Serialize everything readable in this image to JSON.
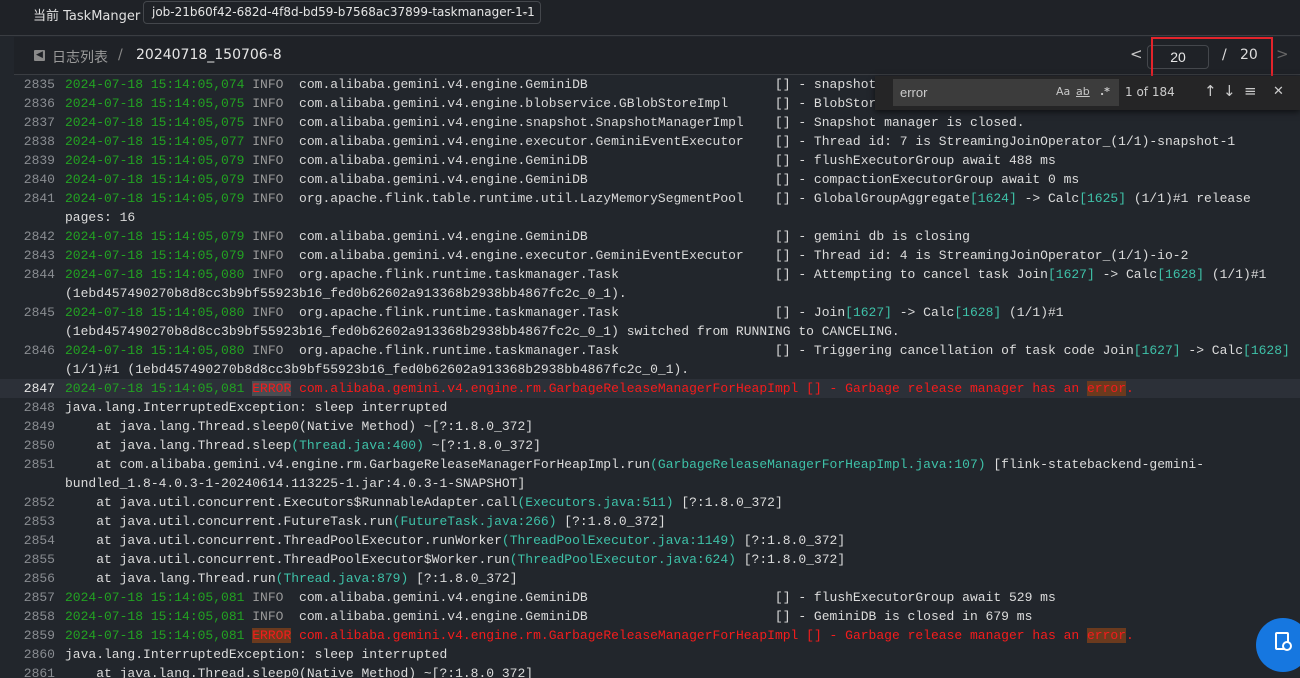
{
  "header": {
    "taskmanager_label": "当前 TaskManger :",
    "taskmanager_value": "job-21b60f42-682d-4f8d-bd59-b7568ac37899-taskmanager-1-1"
  },
  "breadcrumb": {
    "parent": "日志列表",
    "separator": "/",
    "current": "20240718_150706-8"
  },
  "pagination": {
    "prev": "<",
    "current": "20",
    "separator": "/",
    "total": "20",
    "next": ">"
  },
  "find": {
    "query": "error",
    "match_case": "Aa",
    "whole_word": "ab",
    "regex": ".*",
    "count": "1 of 184",
    "prev": "↑",
    "next": "↓",
    "selection": "≡",
    "close": "✕"
  },
  "colors": {
    "timestamp": "#22a322",
    "level": "#9a9a9a",
    "teal": "#3ec1a8",
    "error": "#f51c1c",
    "highlight": "#6b3a1e",
    "accent": "#1677e0",
    "annotation": "#e3242b"
  },
  "log_lines": [
    {
      "n": "2835",
      "parts": [
        [
          "ts",
          "2024-07-18 15:14:05,074"
        ],
        [
          "lvl",
          " INFO  "
        ],
        [
          "logger",
          "com.alibaba.gemini.v4.engine.GeminiDB"
        ],
        [
          "txt",
          "[] - snapshotE"
        ]
      ]
    },
    {
      "n": "2836",
      "parts": [
        [
          "ts",
          "2024-07-18 15:14:05,075"
        ],
        [
          "lvl",
          " INFO  "
        ],
        [
          "logger",
          "com.alibaba.gemini.v4.engine.blobservice.GBlobStoreImpl"
        ],
        [
          "txt",
          "[] - BlobStore"
        ]
      ]
    },
    {
      "n": "2837",
      "parts": [
        [
          "ts",
          "2024-07-18 15:14:05,075"
        ],
        [
          "lvl",
          " INFO  "
        ],
        [
          "logger",
          "com.alibaba.gemini.v4.engine.snapshot.SnapshotManagerImpl"
        ],
        [
          "txt",
          "[] - Snapshot manager is closed."
        ]
      ]
    },
    {
      "n": "2838",
      "parts": [
        [
          "ts",
          "2024-07-18 15:14:05,077"
        ],
        [
          "lvl",
          " INFO  "
        ],
        [
          "logger",
          "com.alibaba.gemini.v4.engine.executor.GeminiEventExecutor"
        ],
        [
          "txt",
          "[] - Thread id: 7 is StreamingJoinOperator_(1/1)-snapshot-1"
        ]
      ]
    },
    {
      "n": "2839",
      "parts": [
        [
          "ts",
          "2024-07-18 15:14:05,079"
        ],
        [
          "lvl",
          " INFO  "
        ],
        [
          "logger",
          "com.alibaba.gemini.v4.engine.GeminiDB"
        ],
        [
          "txt",
          "[] - flushExecutorGroup await 488 ms"
        ]
      ]
    },
    {
      "n": "2840",
      "parts": [
        [
          "ts",
          "2024-07-18 15:14:05,079"
        ],
        [
          "lvl",
          " INFO  "
        ],
        [
          "logger",
          "com.alibaba.gemini.v4.engine.GeminiDB"
        ],
        [
          "txt",
          "[] - compactionExecutorGroup await 0 ms"
        ]
      ]
    },
    {
      "n": "2841",
      "parts": [
        [
          "ts",
          "2024-07-18 15:14:05,079"
        ],
        [
          "lvl",
          " INFO  "
        ],
        [
          "logger",
          "org.apache.flink.table.runtime.util.LazyMemorySegmentPool"
        ],
        [
          "txt",
          "[] - GlobalGroupAggregate"
        ],
        [
          "teal",
          "[1624]"
        ],
        [
          "txt",
          " -> Calc"
        ],
        [
          "teal",
          "[1625]"
        ],
        [
          "txt",
          " (1/1)#1 release pages: 16"
        ]
      ]
    },
    {
      "n": "2842",
      "parts": [
        [
          "ts",
          "2024-07-18 15:14:05,079"
        ],
        [
          "lvl",
          " INFO  "
        ],
        [
          "logger",
          "com.alibaba.gemini.v4.engine.GeminiDB"
        ],
        [
          "txt",
          "[] - gemini db is closing"
        ]
      ]
    },
    {
      "n": "2843",
      "parts": [
        [
          "ts",
          "2024-07-18 15:14:05,079"
        ],
        [
          "lvl",
          " INFO  "
        ],
        [
          "logger",
          "com.alibaba.gemini.v4.engine.executor.GeminiEventExecutor"
        ],
        [
          "txt",
          "[] - Thread id: 4 is StreamingJoinOperator_(1/1)-io-2"
        ]
      ]
    },
    {
      "n": "2844",
      "parts": [
        [
          "ts",
          "2024-07-18 15:14:05,080"
        ],
        [
          "lvl",
          " INFO  "
        ],
        [
          "logger",
          "org.apache.flink.runtime.taskmanager.Task"
        ],
        [
          "txt",
          "[] - Attempting to cancel task Join"
        ],
        [
          "teal",
          "[1627]"
        ],
        [
          "txt",
          " -> Calc"
        ],
        [
          "teal",
          "[1628]"
        ],
        [
          "txt",
          " (1/1)#1 (1ebd457490270b8d8cc3b9bf55923b16_fed0b62602a913368b2938bb4867fc2c_0_1)."
        ]
      ]
    },
    {
      "n": "2845",
      "parts": [
        [
          "ts",
          "2024-07-18 15:14:05,080"
        ],
        [
          "lvl",
          " INFO  "
        ],
        [
          "logger",
          "org.apache.flink.runtime.taskmanager.Task"
        ],
        [
          "txt",
          "[] - Join"
        ],
        [
          "teal",
          "[1627]"
        ],
        [
          "txt",
          " -> Calc"
        ],
        [
          "teal",
          "[1628]"
        ],
        [
          "txt",
          " (1/1)#1 (1ebd457490270b8d8cc3b9bf55923b16_fed0b62602a913368b2938bb4867fc2c_0_1) switched from RUNNING to CANCELING."
        ]
      ]
    },
    {
      "n": "2846",
      "parts": [
        [
          "ts",
          "2024-07-18 15:14:05,080"
        ],
        [
          "lvl",
          " INFO  "
        ],
        [
          "logger",
          "org.apache.flink.runtime.taskmanager.Task"
        ],
        [
          "txt",
          "[] - Triggering cancellation of task code Join"
        ],
        [
          "teal",
          "[1627]"
        ],
        [
          "txt",
          " -> Calc"
        ],
        [
          "teal",
          "[1628]"
        ],
        [
          "txt",
          " (1/1)#1 (1ebd457490270b8d8cc3b9bf55923b16_fed0b62602a913368b2938bb4867fc2c_0_1)."
        ]
      ]
    },
    {
      "n": "2847",
      "current": true,
      "parts": [
        [
          "ts",
          "2024-07-18 15:14:05,081"
        ],
        [
          "txt",
          " "
        ],
        [
          "red cm",
          "ERROR"
        ],
        [
          "red",
          " com.alibaba.gemini.v4.engine.rm.GarbageReleaseManagerForHeapImpl [] - Garbage release manager has an "
        ],
        [
          "red mt",
          "error"
        ],
        [
          "red",
          "."
        ]
      ]
    },
    {
      "n": "2848",
      "parts": [
        [
          "txt",
          "java.lang.InterruptedException: sleep interrupted"
        ]
      ]
    },
    {
      "n": "2849",
      "parts": [
        [
          "txt",
          "    at java.lang.Thread.sleep0(Native Method) ~[?:1.8.0_372]"
        ]
      ]
    },
    {
      "n": "2850",
      "parts": [
        [
          "txt",
          "    at java.lang.Thread.sleep"
        ],
        [
          "teal",
          "(Thread.java:400)"
        ],
        [
          "txt",
          " ~[?:1.8.0_372]"
        ]
      ]
    },
    {
      "n": "2851",
      "parts": [
        [
          "txt",
          "    at com.alibaba.gemini.v4.engine.rm.GarbageReleaseManagerForHeapImpl.run"
        ],
        [
          "teal",
          "(GarbageReleaseManagerForHeapImpl.java:107)"
        ],
        [
          "txt",
          " [flink-statebackend-gemini-bundled_1.8-4.0.3-1-20240614.113225-1.jar:4.0.3-1-SNAPSHOT]"
        ]
      ]
    },
    {
      "n": "2852",
      "parts": [
        [
          "txt",
          "    at java.util.concurrent.Executors$RunnableAdapter.call"
        ],
        [
          "teal",
          "(Executors.java:511)"
        ],
        [
          "txt",
          " [?:1.8.0_372]"
        ]
      ]
    },
    {
      "n": "2853",
      "parts": [
        [
          "txt",
          "    at java.util.concurrent.FutureTask.run"
        ],
        [
          "teal",
          "(FutureTask.java:266)"
        ],
        [
          "txt",
          " [?:1.8.0_372]"
        ]
      ]
    },
    {
      "n": "2854",
      "parts": [
        [
          "txt",
          "    at java.util.concurrent.ThreadPoolExecutor.runWorker"
        ],
        [
          "teal",
          "(ThreadPoolExecutor.java:1149)"
        ],
        [
          "txt",
          " [?:1.8.0_372]"
        ]
      ]
    },
    {
      "n": "2855",
      "parts": [
        [
          "txt",
          "    at java.util.concurrent.ThreadPoolExecutor$Worker.run"
        ],
        [
          "teal",
          "(ThreadPoolExecutor.java:624)"
        ],
        [
          "txt",
          " [?:1.8.0_372]"
        ]
      ]
    },
    {
      "n": "2856",
      "parts": [
        [
          "txt",
          "    at java.lang.Thread.run"
        ],
        [
          "teal",
          "(Thread.java:879)"
        ],
        [
          "txt",
          " [?:1.8.0_372]"
        ]
      ]
    },
    {
      "n": "2857",
      "parts": [
        [
          "ts",
          "2024-07-18 15:14:05,081"
        ],
        [
          "lvl",
          " INFO  "
        ],
        [
          "logger",
          "com.alibaba.gemini.v4.engine.GeminiDB"
        ],
        [
          "txt",
          "[] - flushExecutorGroup await 529 ms"
        ]
      ]
    },
    {
      "n": "2858",
      "parts": [
        [
          "ts",
          "2024-07-18 15:14:05,081"
        ],
        [
          "lvl",
          " INFO  "
        ],
        [
          "logger",
          "com.alibaba.gemini.v4.engine.GeminiDB"
        ],
        [
          "txt",
          "[] - GeminiDB is closed in 679 ms"
        ]
      ]
    },
    {
      "n": "2859",
      "parts": [
        [
          "ts",
          "2024-07-18 15:14:05,081"
        ],
        [
          "txt",
          " "
        ],
        [
          "red mt",
          "ERROR"
        ],
        [
          "red",
          " com.alibaba.gemini.v4.engine.rm.GarbageReleaseManagerForHeapImpl [] - Garbage release manager has an "
        ],
        [
          "red mt",
          "error"
        ],
        [
          "red",
          "."
        ]
      ]
    },
    {
      "n": "2860",
      "parts": [
        [
          "txt",
          "java.lang.InterruptedException: sleep interrupted"
        ]
      ]
    },
    {
      "n": "2861",
      "parts": [
        [
          "txt",
          "    at java.lang.Thread.sleep0(Native Method) ~[?:1.8.0_372]"
        ]
      ]
    }
  ]
}
